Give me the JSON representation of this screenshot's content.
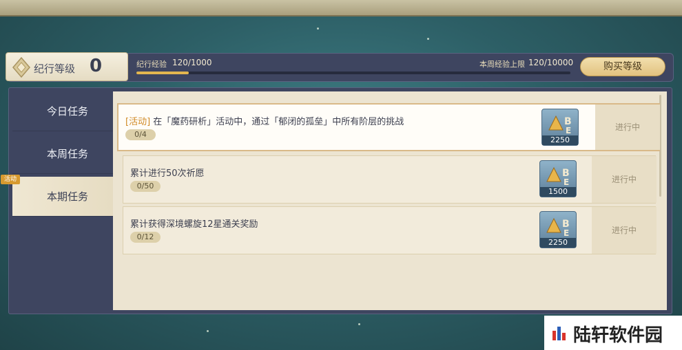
{
  "header": {
    "level_label": "纪行等级",
    "level_value": "0",
    "exp_label": "纪行经验",
    "exp_value": "120/1000",
    "exp_progress": 0.12,
    "weekly_label": "本周经验上限",
    "weekly_value": "120/10000",
    "buy_button": "购买等级"
  },
  "sidebar": {
    "tabs": [
      {
        "label": "今日任务",
        "active": false
      },
      {
        "label": "本周任务",
        "active": false
      },
      {
        "label": "本期任务",
        "active": true
      }
    ],
    "event_badge": "活动"
  },
  "tasks": [
    {
      "tag": "[活动]",
      "title": "在「魔药研析」活动中，通过「郁闭的孤垒」中所有阶层的挑战",
      "progress": "0/4",
      "reward_icon": "bp-exp-icon",
      "reward_amount": "2250",
      "status": "进行中"
    },
    {
      "tag": "",
      "title": "累计进行50次祈愿",
      "progress": "0/50",
      "reward_icon": "bp-exp-icon",
      "reward_amount": "1500",
      "status": "进行中"
    },
    {
      "tag": "",
      "title": "累计获得深境螺旋12星通关奖励",
      "progress": "0/12",
      "reward_icon": "bp-exp-icon",
      "reward_amount": "2250",
      "status": "进行中"
    }
  ],
  "watermark": {
    "text": "陆轩软件园"
  },
  "colors": {
    "accent_gold": "#e3b64f",
    "panel_dark": "#3e4560",
    "panel_light": "#ece4d1",
    "event_tag": "#d08a26"
  }
}
